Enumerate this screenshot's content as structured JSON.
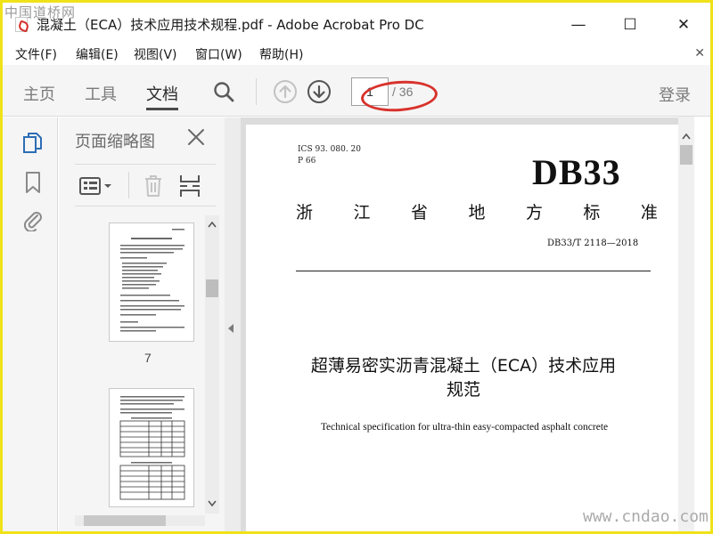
{
  "watermarks": {
    "top": "中国道桥网",
    "bottom": "www.cndao.com"
  },
  "window": {
    "title": "混凝土（ECA）技术应用技术规程.pdf - Adobe Acrobat Pro DC",
    "minimize": "—",
    "maximize": "☐",
    "close": "✕"
  },
  "menu": {
    "items": [
      "文件(F)",
      "编辑(E)",
      "视图(V)",
      "窗口(W)",
      "帮助(H)"
    ],
    "close": "✕"
  },
  "toolbar": {
    "tabs": [
      "主页",
      "工具",
      "文档"
    ],
    "active_tab": "文档",
    "page_current": "1",
    "page_total": "/ 36",
    "login": "登录"
  },
  "thumbnails": {
    "title": "页面缩略图",
    "page_label": "7"
  },
  "document": {
    "ics_line": "ICS 93. 080. 20",
    "p_line": "P 66",
    "code": "DB33",
    "province_chars": [
      "浙",
      "江",
      "省",
      "地",
      "方",
      "标",
      "准"
    ],
    "standard_number": "DB33/T 2118—2018",
    "title_cn_line1": "超薄易密实沥青混凝土（ECA）技术应用",
    "title_cn_line2": "规范",
    "title_en": "Technical specification for ultra-thin easy-compacted asphalt concrete"
  },
  "colors": {
    "frame": "#f0e218",
    "annotation": "#d8322c",
    "accent": "#2d6db5"
  }
}
